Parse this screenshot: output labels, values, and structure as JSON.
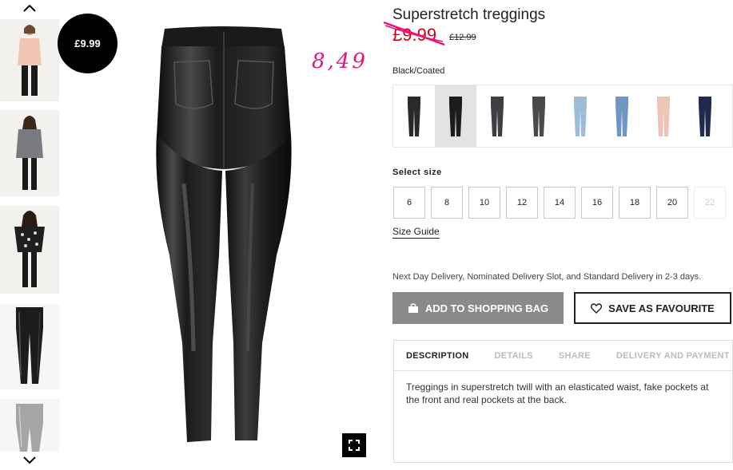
{
  "product": {
    "title": "Superstretch treggings",
    "price_current": "£9.99",
    "price_old": "£12.99",
    "badge_price": "£9.99",
    "handwritten_price": "8,49",
    "color_name": "Black/Coated"
  },
  "swatches": [
    {
      "name": "black",
      "color": "#2a2a2a"
    },
    {
      "name": "black-coated",
      "color": "#1c1c1c"
    },
    {
      "name": "dark-grey",
      "color": "#3d3f45"
    },
    {
      "name": "grey",
      "color": "#4a4a4a"
    },
    {
      "name": "light-blue",
      "color": "#9cbcd8"
    },
    {
      "name": "blue",
      "color": "#6e97c4"
    },
    {
      "name": "pink",
      "color": "#efc4b8"
    },
    {
      "name": "navy",
      "color": "#202a4d"
    }
  ],
  "size_section": {
    "label": "Select size",
    "sizes": [
      "6",
      "8",
      "10",
      "12",
      "14",
      "16",
      "18",
      "20",
      "22"
    ],
    "guide": "Size Guide"
  },
  "delivery": "Next Day Delivery, Nominated Delivery Slot, and Standard Delivery in 2-3 days.",
  "buttons": {
    "add_to_bag": "ADD TO SHOPPING BAG",
    "save_favourite": "SAVE AS FAVOURITE"
  },
  "tabs": [
    "DESCRIPTION",
    "DETAILS",
    "SHARE",
    "DELIVERY AND PAYMENT"
  ],
  "description": "Treggings in superstretch twill with an elasticated waist, fake pockets at the front and real pockets at the back.",
  "colors": {
    "sale_red": "#d0021b",
    "handwriting_pink": "#e6157a",
    "add_bag_grey": "#8a8a8a"
  },
  "icons": [
    "chevron-up-icon",
    "chevron-down-icon",
    "fullscreen-icon",
    "shopping-bag-icon",
    "heart-icon"
  ]
}
